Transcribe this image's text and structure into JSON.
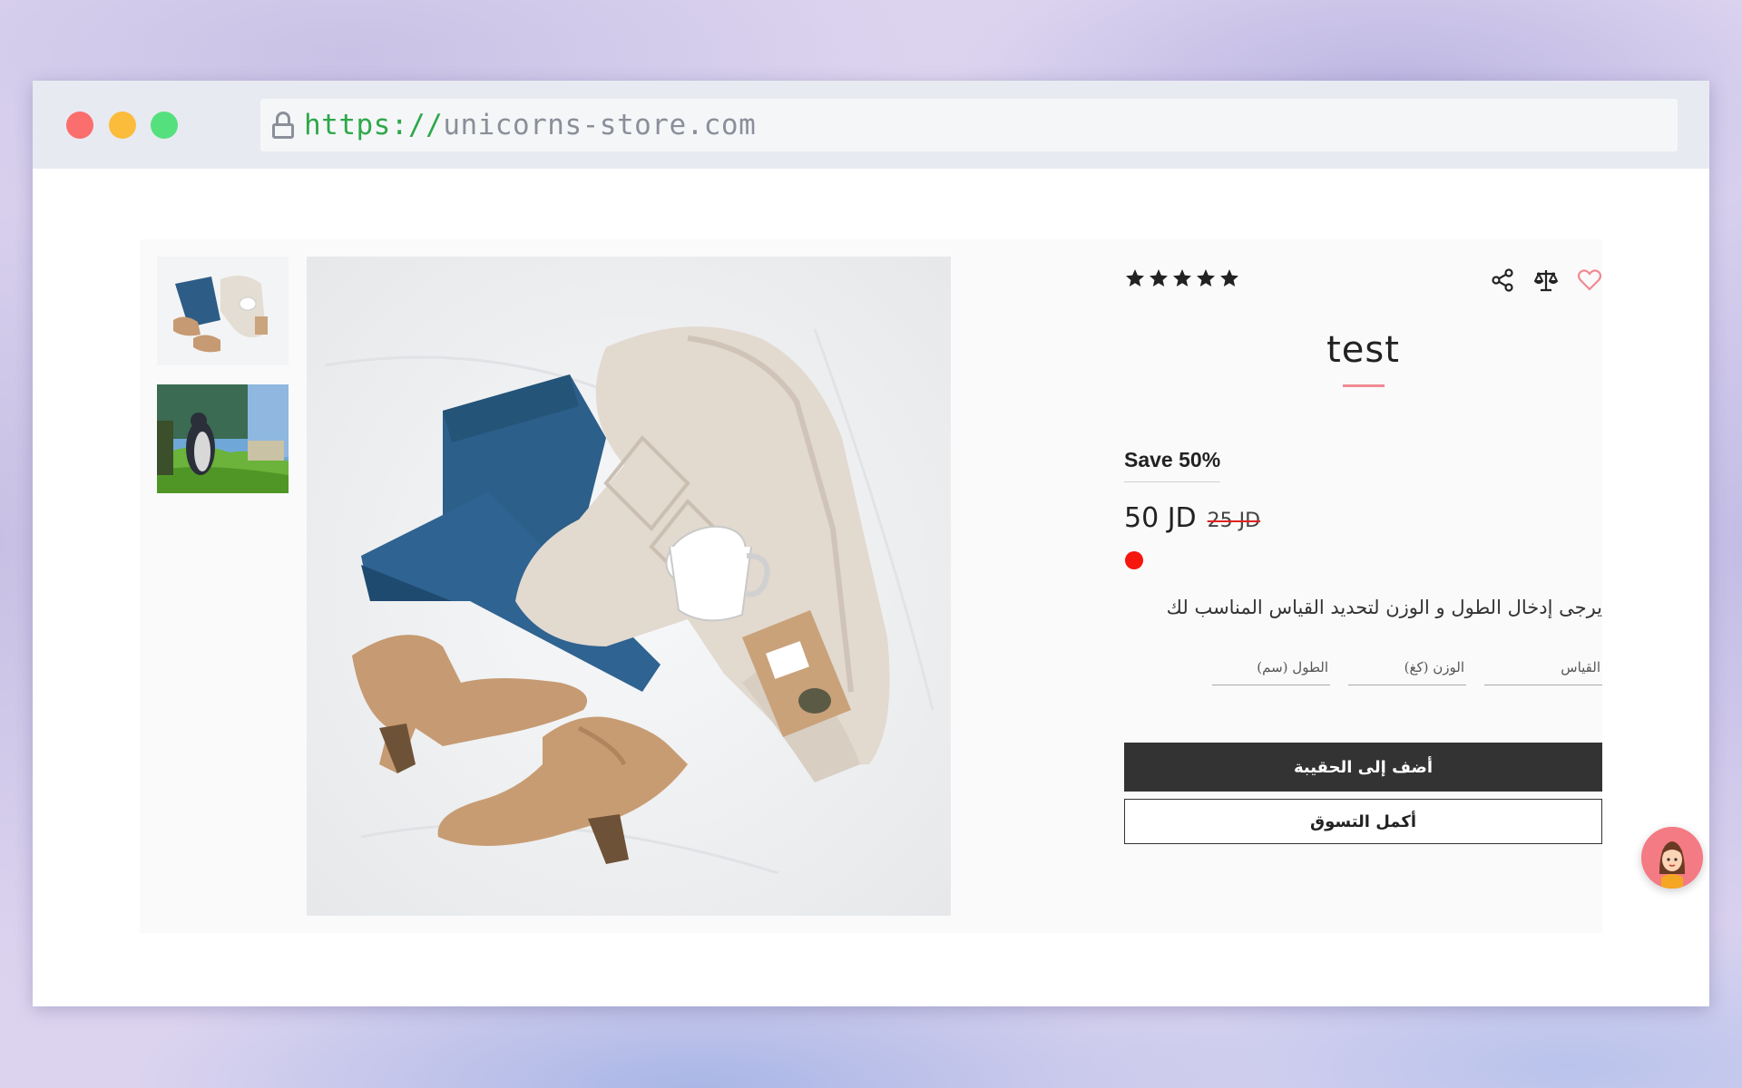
{
  "browser": {
    "url_scheme": "https://",
    "url_host": "unicorns-store.com"
  },
  "gallery": {
    "thumbnails": [
      "outfit-thumbnail",
      "cartoon-penguin-thumbnail"
    ],
    "main_image": "outfit-flatlay"
  },
  "product": {
    "rating_stars": 5,
    "title": "test",
    "save_label": "Save 50%",
    "price_new": "50 JD",
    "price_old": "25 JD",
    "color": "#f5160e",
    "size_hint": "يرجى إدخال الطول و الوزن لتحديد القياس المناسب لك",
    "fields": {
      "size": "القياس",
      "weight": "الوزن (كغ)",
      "height": "الطول (سم)"
    },
    "add_to_bag": "أضف إلى الحقيبة",
    "continue_shopping": "أكمل التسوق"
  },
  "icons": [
    "share-icon",
    "compare-scale-icon",
    "heart-icon",
    "star-icon",
    "lock-icon",
    "chat-avatar-icon"
  ],
  "colors": {
    "accent": "#f08a93",
    "dark_button": "#333333",
    "url_green": "#2da84a"
  }
}
